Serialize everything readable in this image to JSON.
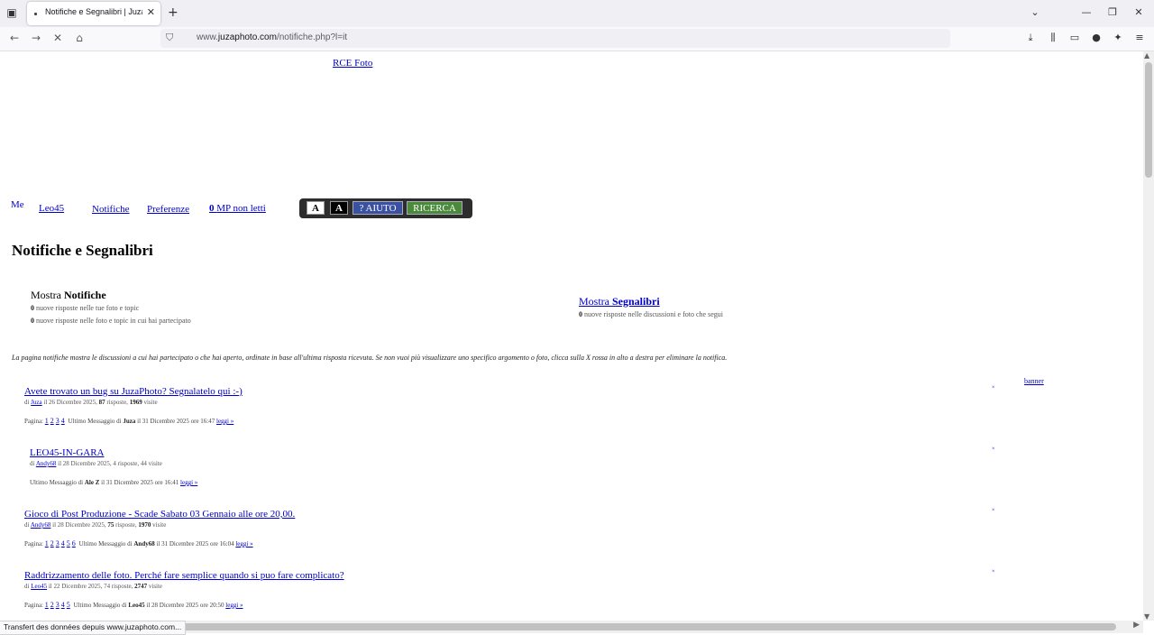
{
  "browser": {
    "tab_title": "Notifiche e Segnalibri | JuzaPhoto",
    "url_prefix": "www.",
    "url_domain": "juzaphoto.com",
    "url_path": "/notifiche.php?l=it",
    "status_text": "Transfert des données depuis www.juzaphoto.com..."
  },
  "header": {
    "rce": "RCE Foto",
    "me": "Me",
    "user": "Leo45",
    "notifiche": "Notifiche",
    "preferenze": "Preferenze",
    "mp_count": "0",
    "mp_label": "MP non letti",
    "btn_a_light": "A",
    "btn_a_dark": "A",
    "btn_help": "? AIUTO",
    "btn_search": "RICERCA"
  },
  "main": {
    "title": "Notifiche e Segnalibri",
    "show_prefix": "Mostra",
    "show_notif": "Notifiche",
    "show_bm": "Segnalibri",
    "stat1_n": "0",
    "stat1_t": "nuove risposte nelle tue foto e topic",
    "stat2_n": "0",
    "stat2_t": "nuove risposte nelle foto e topic in cui hai partecipato",
    "stat3_n": "0",
    "stat3_t": "nuove risposte nelle discussioni e foto che segui",
    "info": "La pagina notifiche mostra le discussioni a cui hai partecipato o che hai aperto, ordinate in base all'ultima risposta ricevuta. Se non vuoi più visualizzare uno specifico argomento o foto, clicca sulla X rossa in alto a destra per eliminare la notifica.",
    "banner": "banner",
    "x_mark": "×"
  },
  "topics": [
    {
      "title": "Avete trovato un bug su JuzaPhoto? Segnalatelo qui :-)",
      "by": "di",
      "author": "Juza",
      "date": "il 26 Dicembre 2025,",
      "replies": "87",
      "replies_t": "risposte,",
      "visits": "1969",
      "visits_t": "visite",
      "pages_label": "Pagina:",
      "pages": [
        "1",
        "2",
        "3",
        "4"
      ],
      "last_t": "Ultimo Messaggio di",
      "last_user": "Juza",
      "last_date": "il 31 Dicembre 2025 ore 16:47",
      "read": "leggi »"
    },
    {
      "title": "LEO45-IN-GARA",
      "by": "di",
      "author": "Andy68",
      "date": "il 28 Dicembre 2025,",
      "replies": "4",
      "replies_t": "risposte,",
      "visits": "44",
      "visits_t": "visite",
      "last_t": "Ultimo Messaggio di",
      "last_user": "Ale Z",
      "last_date": "il 31 Dicembre 2025 ore 16:41",
      "read": "leggi »"
    },
    {
      "title": "Gioco di Post Produzione - Scade Sabato 03 Gennaio alle ore 20,00.",
      "by": "di",
      "author": "Andy68",
      "date": "il 28 Dicembre 2025,",
      "replies": "75",
      "replies_t": "risposte,",
      "visits": "1970",
      "visits_t": "visite",
      "pages_label": "Pagina:",
      "pages": [
        "1",
        "2",
        "3",
        "4",
        "5",
        "6"
      ],
      "last_t": "Ultimo Messaggio di",
      "last_user": "Andy68",
      "last_date": "il 31 Dicembre 2025 ore 16:04",
      "read": "leggi »"
    },
    {
      "title": "Raddrizzamento delle foto. Perché fare semplice quando si puo fare complicato?",
      "by": "di",
      "author": "Leo45",
      "date": "il 22 Dicembre 2025,",
      "replies": "74",
      "replies_t": "risposte,",
      "visits": "2747",
      "visits_t": "visite",
      "pages_label": "Pagina:",
      "pages": [
        "1",
        "2",
        "3",
        "4",
        "5"
      ],
      "last_t": "Ultimo Messaggio di",
      "last_user": "Leo45",
      "last_date": "il 28 Dicembre 2025 ore 20:50",
      "read": "leggi »"
    }
  ]
}
